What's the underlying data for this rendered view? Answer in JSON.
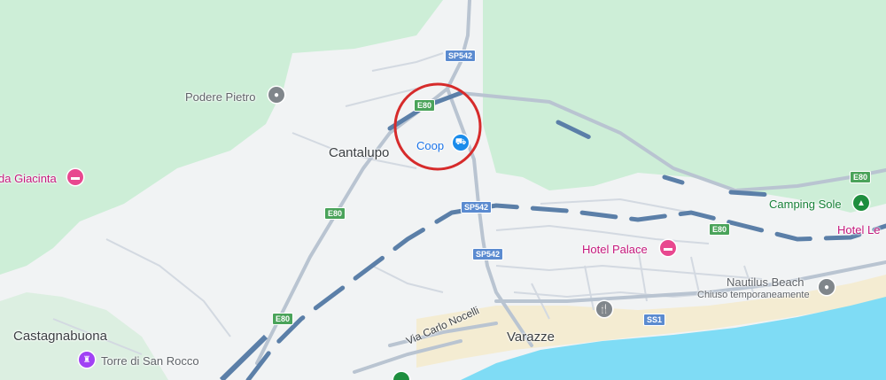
{
  "places": {
    "cantalupo": "Cantalupo",
    "castagnabuona": "Castagnabuona",
    "varazze": "Varazze"
  },
  "pois": {
    "podere_pietro": "Podere Pietro",
    "da_giacinta": "da Giacinta",
    "coop": "Coop",
    "camping_sole": "Camping Sole",
    "hotel_palace": "Hotel Palace",
    "hotel_le": "Hotel Le",
    "nautilus_beach": "Nautilus Beach",
    "nautilus_status": "Chiuso temporaneamente",
    "torre_san_rocco": "Torre di San Rocco"
  },
  "streets": {
    "via_carlo_nocelli": "Via Carlo Nocelli"
  },
  "road_shields": {
    "sp542_top": "SP542",
    "sp542_mid": "SP542",
    "sp542_low": "SP542",
    "e80_circle": "E80",
    "e80_left": "E80",
    "e80_right": "E80",
    "e80_far_right": "E80",
    "e80_bottom": "E80",
    "ss1": "SS1"
  },
  "icons": {
    "podere_pietro": "place-pin-icon",
    "da_giacinta": "hotel-bed-icon",
    "coop": "shopping-cart-icon",
    "camping_sole": "camping-tent-icon",
    "hotel_palace": "hotel-bed-icon",
    "nautilus_beach": "place-pin-icon",
    "torre_san_rocco": "monument-tower-icon",
    "restaurant": "restaurant-fork-knife-icon"
  },
  "colors": {
    "land": "#f1f3f4",
    "forest": "#cdeed7",
    "sea": "#7fdcf5",
    "beach": "#f4ecd2",
    "highway": "#5b7fa8",
    "road": "#c4cdd8",
    "highlight_circle": "#d62b2b"
  }
}
